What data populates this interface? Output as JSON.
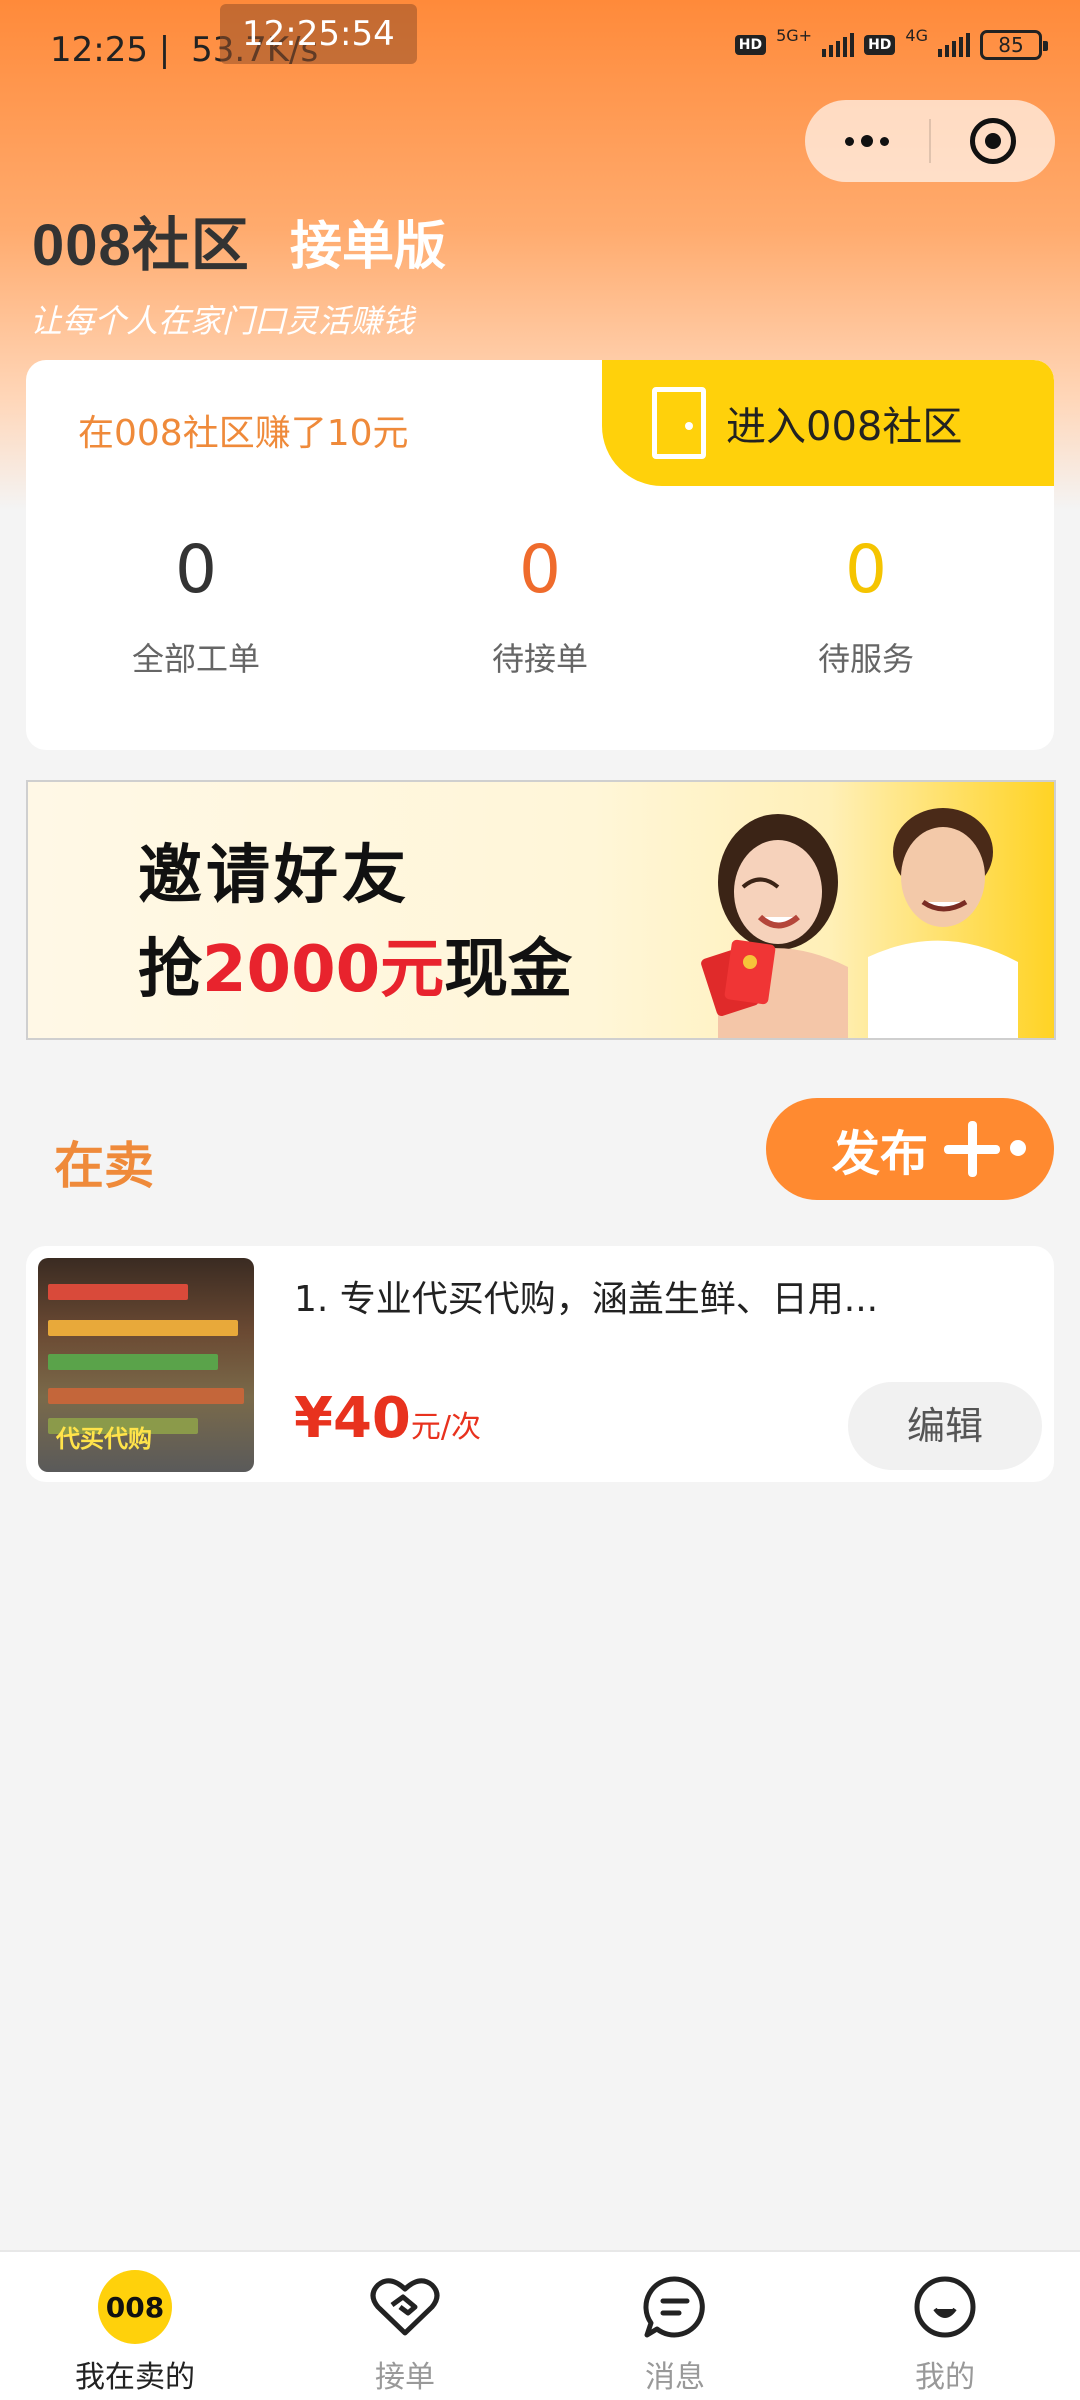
{
  "status_bar": {
    "time": "12:25",
    "speed": "53.7K/s",
    "overlay_time": "12:25:54",
    "hd": "HD",
    "net1": "5G+",
    "net2": "4G",
    "battery": "85"
  },
  "header": {
    "logo": "008社区",
    "subtitle": "接单版",
    "slogan": "让每个人在家门口灵活赚钱"
  },
  "stats_card": {
    "earned": "在008社区赚了10元",
    "enter_label": "进入008社区",
    "stats": [
      {
        "value": "0",
        "label": "全部工单",
        "color": "#333333"
      },
      {
        "value": "0",
        "label": "待接单",
        "color": "#ef6b2c"
      },
      {
        "value": "0",
        "label": "待服务",
        "color": "#f5c400"
      }
    ]
  },
  "banner": {
    "line1": "邀请好友",
    "line2_prefix": "抢",
    "line2_highlight": "2000元",
    "line2_suffix": "现金"
  },
  "selling": {
    "title": "在卖",
    "publish_label": "发布",
    "items": [
      {
        "title": "1. 专业代买代购，涵盖生鲜、日用...",
        "thumb_label": "代买代购",
        "price": "¥40",
        "unit": "元/次",
        "edit_label": "编辑"
      }
    ]
  },
  "tab_bar": {
    "home_badge": "008",
    "tabs": [
      {
        "label": "我在卖的",
        "icon": "home-badge-icon",
        "active": true
      },
      {
        "label": "接单",
        "icon": "handshake-heart-icon",
        "active": false
      },
      {
        "label": "消息",
        "icon": "chat-bubble-icon",
        "active": false
      },
      {
        "label": "我的",
        "icon": "smiley-face-icon",
        "active": false
      }
    ]
  },
  "colors": {
    "orange": "#ff8a30",
    "yellow": "#ffd10b",
    "red": "#e8321e"
  }
}
